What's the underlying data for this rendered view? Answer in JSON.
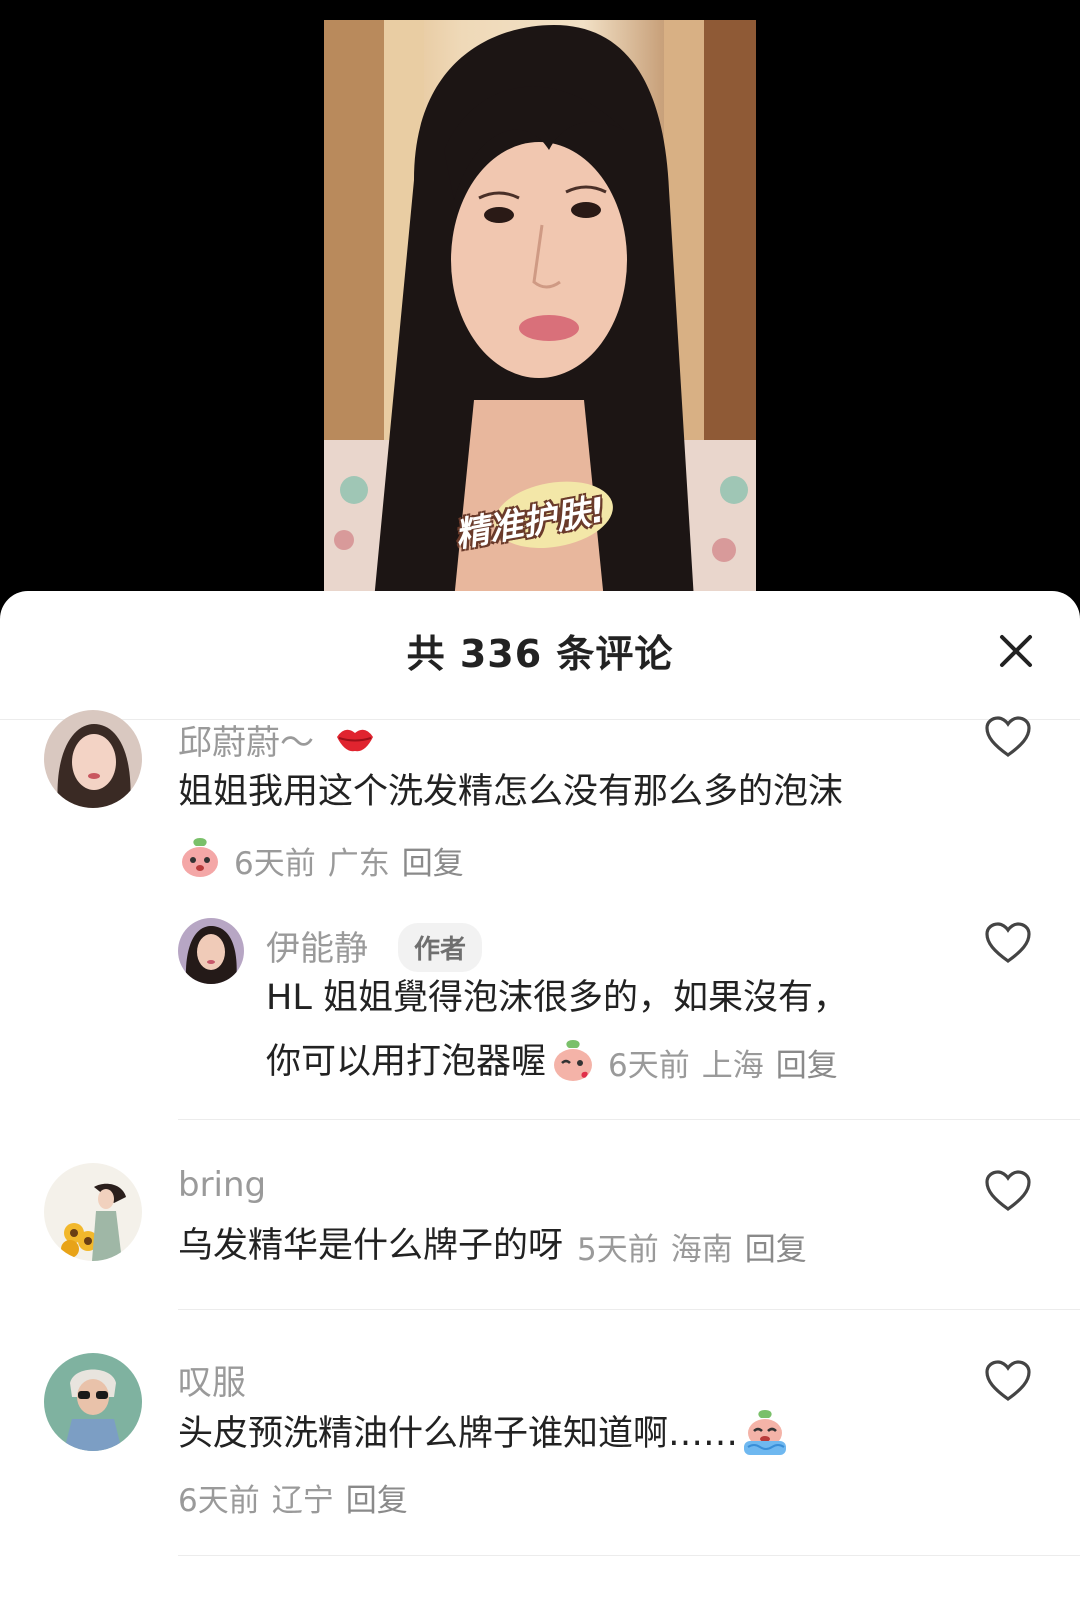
{
  "video": {
    "caption": "精准护肤!"
  },
  "sheet": {
    "title": "共 336 条评论"
  },
  "comments": [
    {
      "user": "邱蔚蔚～",
      "text": "姐姐我用这个洗发精怎么没有那么多的泡沫",
      "time": "6天前",
      "location": "广东",
      "reply": "回复"
    },
    {
      "user": "伊能静",
      "tag": "作者",
      "text_line1": "HL 姐姐覺得泡沫很多的，如果沒有，",
      "text_line2": "你可以用打泡器喔",
      "time": "6天前",
      "location": "上海",
      "reply": "回复"
    },
    {
      "user": "bring",
      "text": "乌发精华是什么牌子的呀",
      "time": "5天前",
      "location": "海南",
      "reply": "回复"
    },
    {
      "user": "叹服",
      "text": "头皮预洗精油什么牌子谁知道啊……",
      "time": "6天前",
      "location": "辽宁",
      "reply": "回复"
    }
  ],
  "colors": {
    "text_primary": "#222222",
    "text_secondary": "#9a9a9a",
    "divider": "#ececec",
    "sheet_bg": "#ffffff",
    "video_bg": "#000000"
  },
  "icons": [
    "close-icon",
    "heart-outline-icon",
    "kiss-lips-icon",
    "peach-emoji-icon",
    "crying-emoji-icon"
  ]
}
